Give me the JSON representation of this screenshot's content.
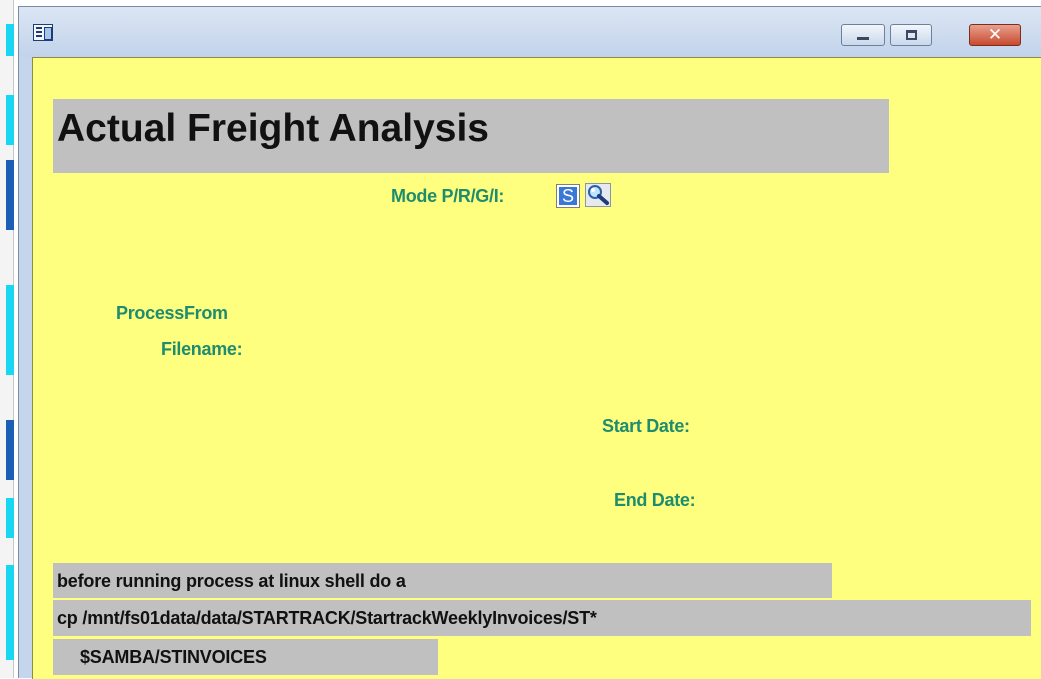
{
  "window": {
    "title": "",
    "close_glyph": "✕"
  },
  "form": {
    "title": "Actual Freight Analysis",
    "mode_label": "Mode P/R/G/I:",
    "mode_value": "S",
    "process_from_label": "ProcessFrom",
    "filename_label": "Filename:",
    "start_date_label": "Start Date:",
    "end_date_label": "End Date:"
  },
  "notes": [
    "before running process at linux shell do a",
    "cp /mnt/fs01data/data/STARTRACK/StartrackWeeklyInvoices/ST*",
    "$SAMBA/STINVOICES"
  ],
  "icons": {
    "app": "app-window-icon",
    "lookup": "magnifier-icon"
  },
  "colors": {
    "client_background": "#ffff7f",
    "label_text": "#1e8c6e",
    "text_box_background": "#c0c0c0",
    "mode_highlight": "#3a78d8"
  }
}
